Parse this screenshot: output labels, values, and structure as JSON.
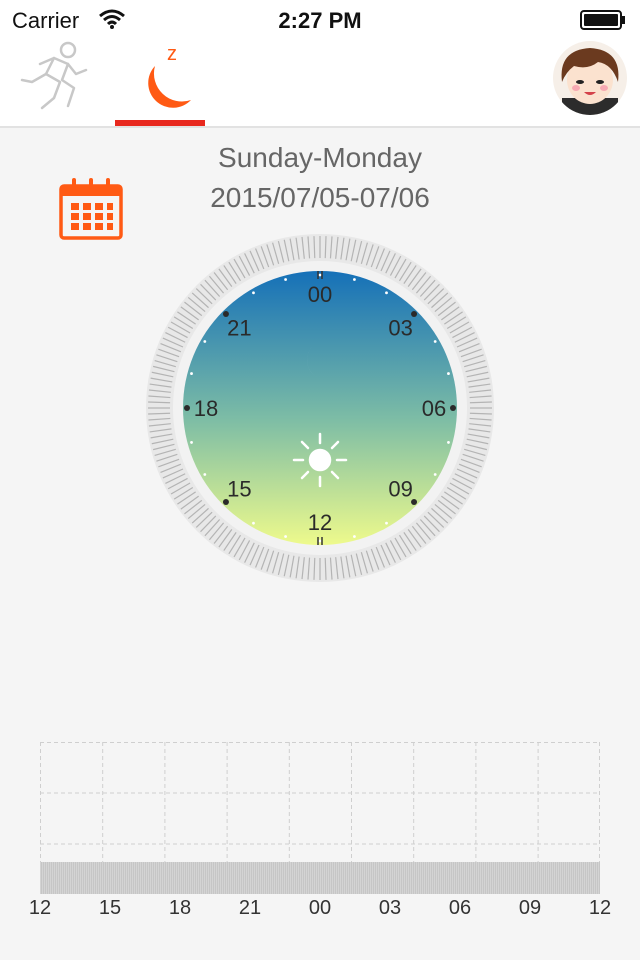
{
  "status_bar": {
    "carrier": "Carrier",
    "time": "2:27 PM"
  },
  "nav": {
    "tabs": [
      {
        "id": "activity",
        "icon": "running-person-icon",
        "active": false
      },
      {
        "id": "sleep",
        "icon": "moon-sleep-icon",
        "active": true,
        "badge": "z"
      }
    ],
    "accent_color": "#ff5a14",
    "indicator_color": "#e8281e"
  },
  "header": {
    "day_range": "Sunday-Monday",
    "date_range": "2015/07/05-07/06"
  },
  "clock": {
    "hour_labels": [
      "00",
      "03",
      "06",
      "09",
      "12",
      "15",
      "18",
      "21"
    ],
    "gradient_top": "#1570b8",
    "gradient_bottom": "#eefa8c"
  },
  "timeline": {
    "ticks": [
      "12",
      "15",
      "18",
      "21",
      "00",
      "03",
      "06",
      "09",
      "12"
    ]
  }
}
